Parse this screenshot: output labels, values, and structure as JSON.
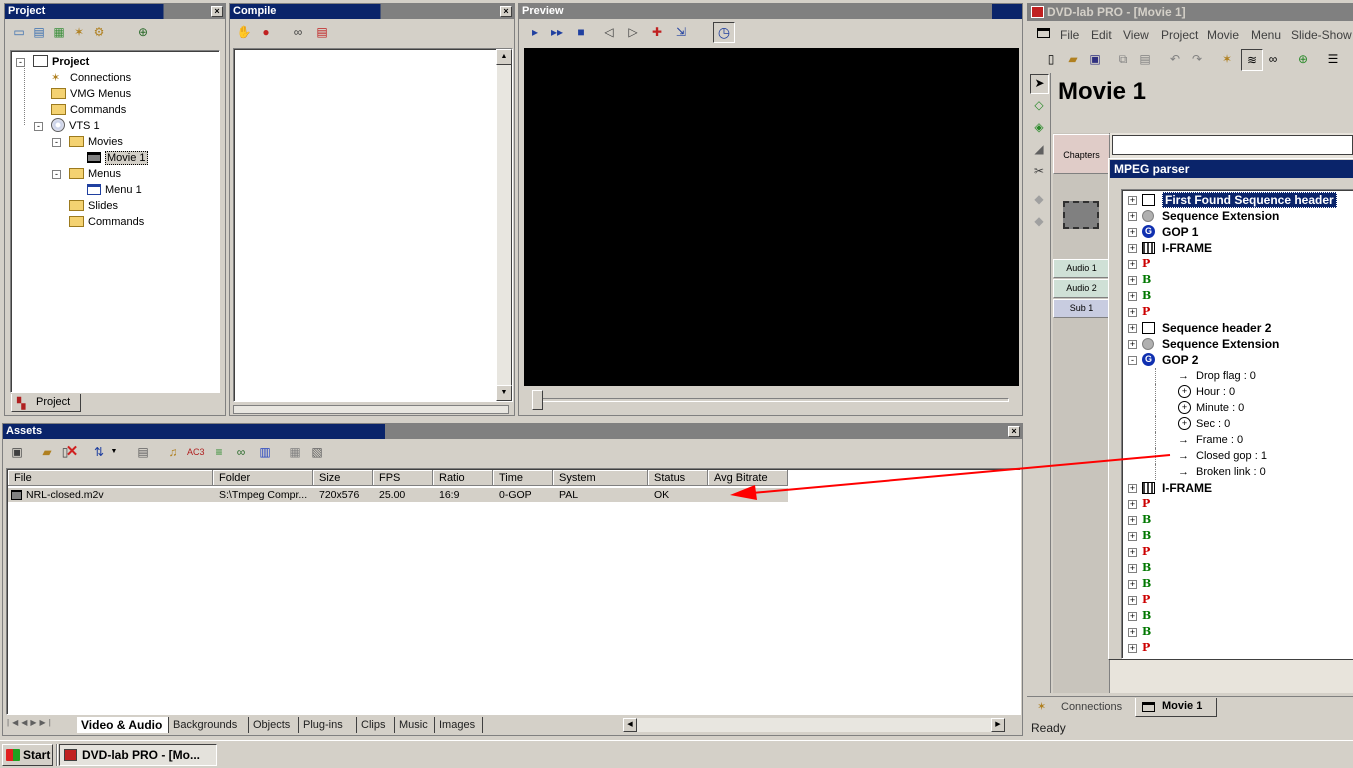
{
  "project_panel": {
    "title": "Project",
    "tree": [
      {
        "label": "Project",
        "level": 0,
        "bold": true,
        "expander": "-"
      },
      {
        "label": "Connections",
        "level": 1
      },
      {
        "label": "VMG Menus",
        "level": 1
      },
      {
        "label": "Commands",
        "level": 1
      },
      {
        "label": "VTS 1",
        "level": 1,
        "expander": "-"
      },
      {
        "label": "Movies",
        "level": 2,
        "expander": "-"
      },
      {
        "label": "Movie 1",
        "level": 3,
        "selected": true
      },
      {
        "label": "Menus",
        "level": 2,
        "expander": "-"
      },
      {
        "label": "Menu 1",
        "level": 3
      },
      {
        "label": "Slides",
        "level": 2
      },
      {
        "label": "Commands",
        "level": 2
      }
    ],
    "tab_label": "Project"
  },
  "compile_panel": {
    "title": "Compile"
  },
  "preview_panel": {
    "title": "Preview"
  },
  "assets_panel": {
    "title": "Assets",
    "columns": [
      "File",
      "Folder",
      "Size",
      "FPS",
      "Ratio",
      "Time",
      "System",
      "Status",
      "Avg Bitrate"
    ],
    "rows": [
      [
        "NRL-closed.m2v",
        "S:\\Tmpeg Compr...",
        "720x576",
        "25.00",
        "16:9",
        "0-GOP",
        "PAL",
        "OK",
        ""
      ]
    ],
    "tabs": [
      "Video & Audio",
      "Backgrounds",
      "Objects",
      "Plug-ins",
      "Clips",
      "Music",
      "Images"
    ],
    "active_tab": "Video & Audio"
  },
  "app_window": {
    "title": "DVD-lab PRO  - [Movie 1]",
    "menu": [
      "File",
      "Edit",
      "View",
      "Project",
      "Movie",
      "Menu",
      "Slide-Show"
    ],
    "movie_heading": "Movie 1",
    "side_buttons": [
      "Chapters",
      "Audio 1",
      "Audio 2",
      "Sub 1"
    ],
    "bottom_tabs": [
      "Connections",
      "Movie 1"
    ],
    "status": "Ready"
  },
  "mpeg_parser": {
    "title": "MPEG parser",
    "rows": [
      {
        "text": "First Found Sequence header",
        "icon": "sequence",
        "bold": true,
        "selected": true,
        "indent": 0
      },
      {
        "text": "Sequence Extension",
        "icon": "extension",
        "bold": true,
        "indent": 0
      },
      {
        "text": "GOP 1",
        "icon": "gop",
        "bold": true,
        "indent": 0
      },
      {
        "text": "I-FRAME",
        "icon": "iframe",
        "bold": true,
        "indent": 0
      },
      {
        "text": "P",
        "icon": "p",
        "indent": 0
      },
      {
        "text": "B",
        "icon": "b",
        "indent": 0
      },
      {
        "text": "B",
        "icon": "b",
        "indent": 0
      },
      {
        "text": "P",
        "icon": "p",
        "indent": 0
      },
      {
        "text": "Sequence header 2",
        "icon": "sequence",
        "bold": true,
        "indent": 0
      },
      {
        "text": "Sequence Extension",
        "icon": "extension",
        "bold": true,
        "indent": 0
      },
      {
        "text": "GOP 2",
        "icon": "gop",
        "bold": true,
        "expanded": true,
        "indent": 0
      },
      {
        "text": "Drop flag : 0",
        "icon": "arrow",
        "indent": 1
      },
      {
        "text": "Hour : 0",
        "icon": "clock",
        "indent": 1
      },
      {
        "text": "Minute : 0",
        "icon": "clock",
        "indent": 1
      },
      {
        "text": "Sec : 0",
        "icon": "clock",
        "indent": 1
      },
      {
        "text": "Frame : 0",
        "icon": "arrow",
        "indent": 1
      },
      {
        "text": "Closed gop : 1",
        "icon": "arrow",
        "indent": 1
      },
      {
        "text": "Broken link : 0",
        "icon": "arrow",
        "indent": 1
      },
      {
        "text": "I-FRAME",
        "icon": "iframe",
        "bold": true,
        "indent": 0
      },
      {
        "text": "P",
        "icon": "p",
        "indent": 0
      },
      {
        "text": "B",
        "icon": "b",
        "indent": 0
      },
      {
        "text": "B",
        "icon": "b",
        "indent": 0
      },
      {
        "text": "P",
        "icon": "p",
        "indent": 0
      },
      {
        "text": "B",
        "icon": "b",
        "indent": 0
      },
      {
        "text": "B",
        "icon": "b",
        "indent": 0
      },
      {
        "text": "P",
        "icon": "p",
        "indent": 0
      },
      {
        "text": "B",
        "icon": "b",
        "indent": 0
      },
      {
        "text": "B",
        "icon": "b",
        "indent": 0
      },
      {
        "text": "P",
        "icon": "p",
        "indent": 0
      }
    ]
  },
  "taskbar": {
    "start_label": "Start",
    "task_label": "DVD-lab PRO  - [Mo..."
  },
  "colors": {
    "title_active": "#0a246a",
    "p_frame": "#cc0000",
    "b_frame": "#007700",
    "annotation_arrow": "#ff0000"
  }
}
